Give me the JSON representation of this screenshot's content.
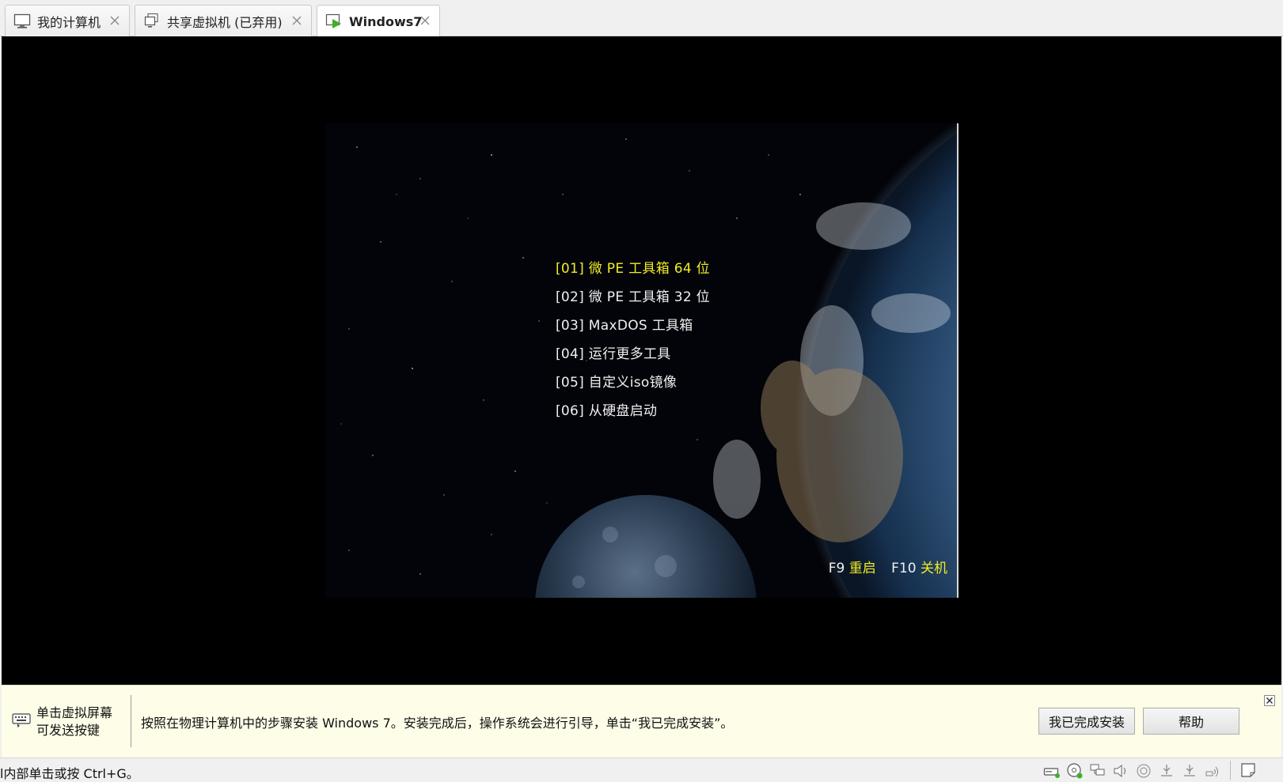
{
  "tabs": [
    {
      "label": "我的计算机",
      "icon": "computer-icon",
      "active": false
    },
    {
      "label": "共享虚拟机 (已弃用)",
      "icon": "shared-vm-icon",
      "active": false
    },
    {
      "label": "Windows7",
      "icon": "vm-running-icon",
      "active": true
    }
  ],
  "boot_menu": {
    "items": [
      {
        "label": "[01] 微 PE 工具箱 64 位",
        "selected": true
      },
      {
        "label": "[02] 微 PE 工具箱 32 位",
        "selected": false
      },
      {
        "label": "[03] MaxDOS 工具箱",
        "selected": false
      },
      {
        "label": "[04] 运行更多工具",
        "selected": false
      },
      {
        "label": "[05] 自定义iso镜像",
        "selected": false
      },
      {
        "label": "[06] 从硬盘启动",
        "selected": false
      }
    ],
    "f9_key": "F9",
    "f9_action": "重启",
    "f10_key": "F10",
    "f10_action": "关机",
    "selected_color": "#f1ec25",
    "text_color": "#f0f0f0"
  },
  "hint_bar": {
    "left_line1": "单击虚拟屏幕",
    "left_line2": "可发送按键",
    "message": "按照在物理计算机中的步骤安装 Windows 7。安装完成后，操作系统会进行引导，单击“我已完成安装”。",
    "finish_button": "我已完成安装",
    "help_button": "帮助"
  },
  "status_bar": {
    "text": "l内部单击或按 Ctrl+G。",
    "icons": [
      "hard-disk-icon",
      "cd-dvd-icon",
      "network-adapter-icon",
      "sound-card-icon",
      "usb-controller-icon",
      "usb-device-icon",
      "usb-device-2-icon",
      "wireless-icon",
      "message-log-icon"
    ]
  },
  "colors": {
    "accent_green": "#3fae2a",
    "hint_bg": "#fdfde8"
  }
}
